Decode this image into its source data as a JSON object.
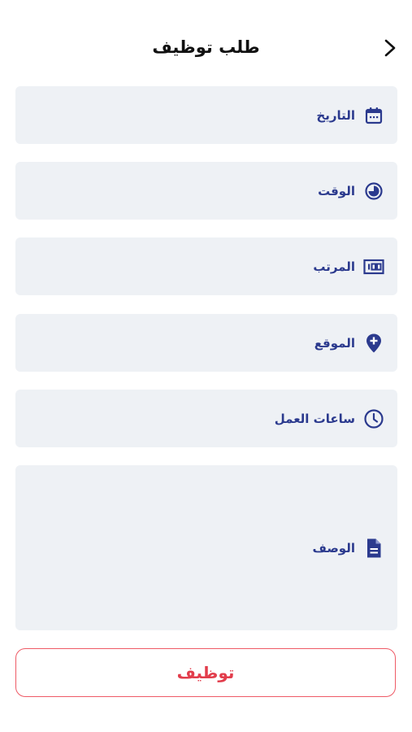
{
  "header": {
    "title": "طلب توظيف",
    "back_icon": "chevron-right-icon"
  },
  "form": {
    "fields": [
      {
        "label": "التاريخ",
        "icon": "calendar-icon"
      },
      {
        "label": "الوقت",
        "icon": "time-dial-icon"
      },
      {
        "label": "المرتب",
        "icon": "salary-icon"
      },
      {
        "label": "الموقع",
        "icon": "location-pin-icon"
      },
      {
        "label": "ساعات العمل",
        "icon": "clock-icon"
      },
      {
        "label": "الوصف",
        "icon": "document-icon"
      }
    ]
  },
  "submit": {
    "label": "توظيف"
  },
  "colors": {
    "field_background": "#eef1f5",
    "label_color": "#2b3a8e",
    "accent_red": "#e23d4c"
  }
}
